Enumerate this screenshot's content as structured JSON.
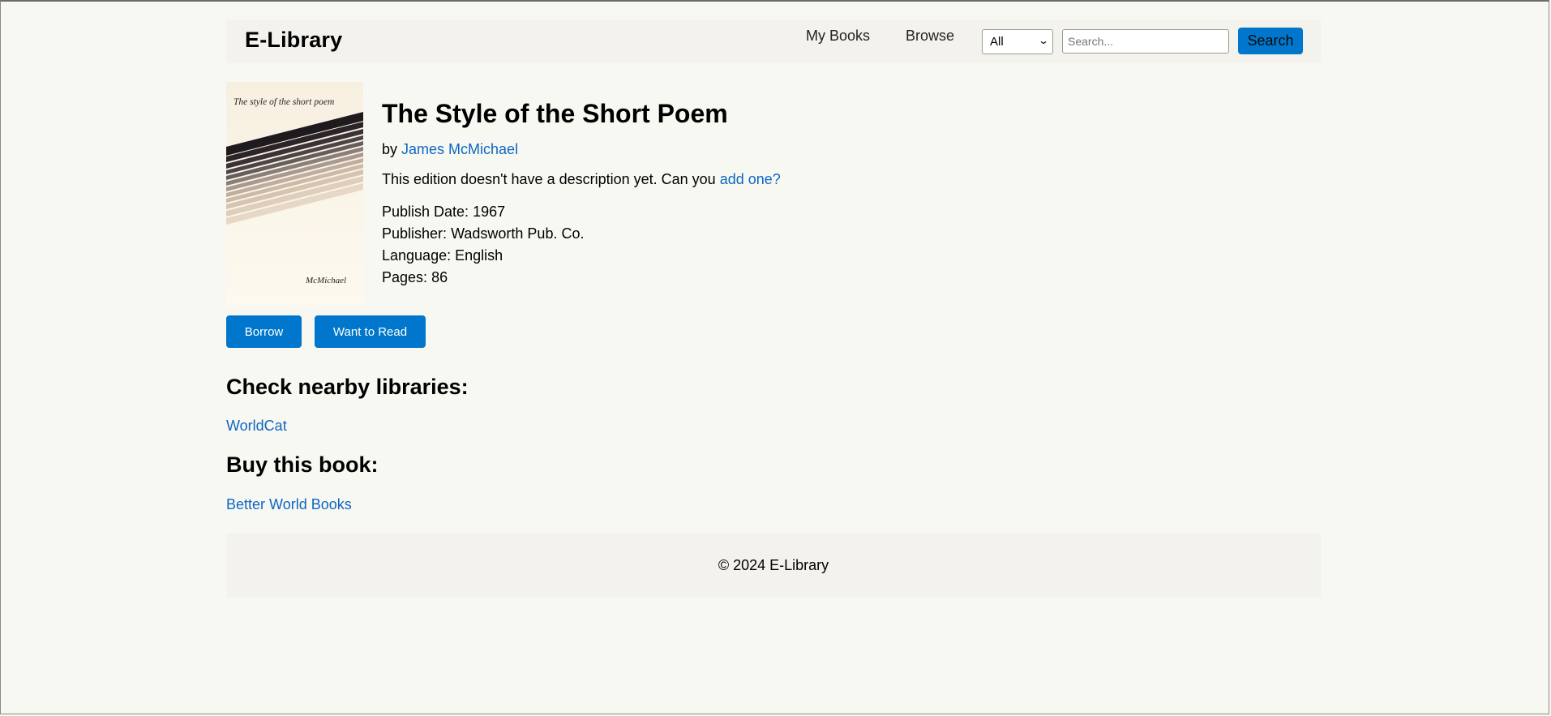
{
  "header": {
    "logo": "E-Library",
    "nav": {
      "my_books": "My Books",
      "browse": "Browse"
    },
    "search": {
      "scope_value": "All",
      "placeholder": "Search...",
      "button_label": "Search"
    }
  },
  "book": {
    "cover": {
      "title_text": "The style of the short poem",
      "author_text": "McMichael"
    },
    "title": "The Style of the Short Poem",
    "by_prefix": "by",
    "author": "James McMichael",
    "description_text": "This edition doesn't have a description yet. Can you",
    "description_link": "add one?",
    "publish_date_label": "Publish Date:",
    "publish_date": "1967",
    "publisher_label": "Publisher:",
    "publisher": "Wadsworth Pub. Co.",
    "language_label": "Language:",
    "language": "English",
    "pages_label": "Pages:",
    "pages": "86"
  },
  "actions": {
    "borrow": "Borrow",
    "want_to_read": "Want to Read"
  },
  "libraries": {
    "heading": "Check nearby libraries:",
    "worldcat": "WorldCat"
  },
  "buy": {
    "heading": "Buy this book:",
    "better_world_books": "Better World Books"
  },
  "footer": {
    "copyright": "© 2024 E-Library"
  },
  "colors": {
    "accent": "#0077cc",
    "link": "#0d66c2",
    "page_bg": "#f8f8f3",
    "panel_bg": "#f3f2ec"
  }
}
